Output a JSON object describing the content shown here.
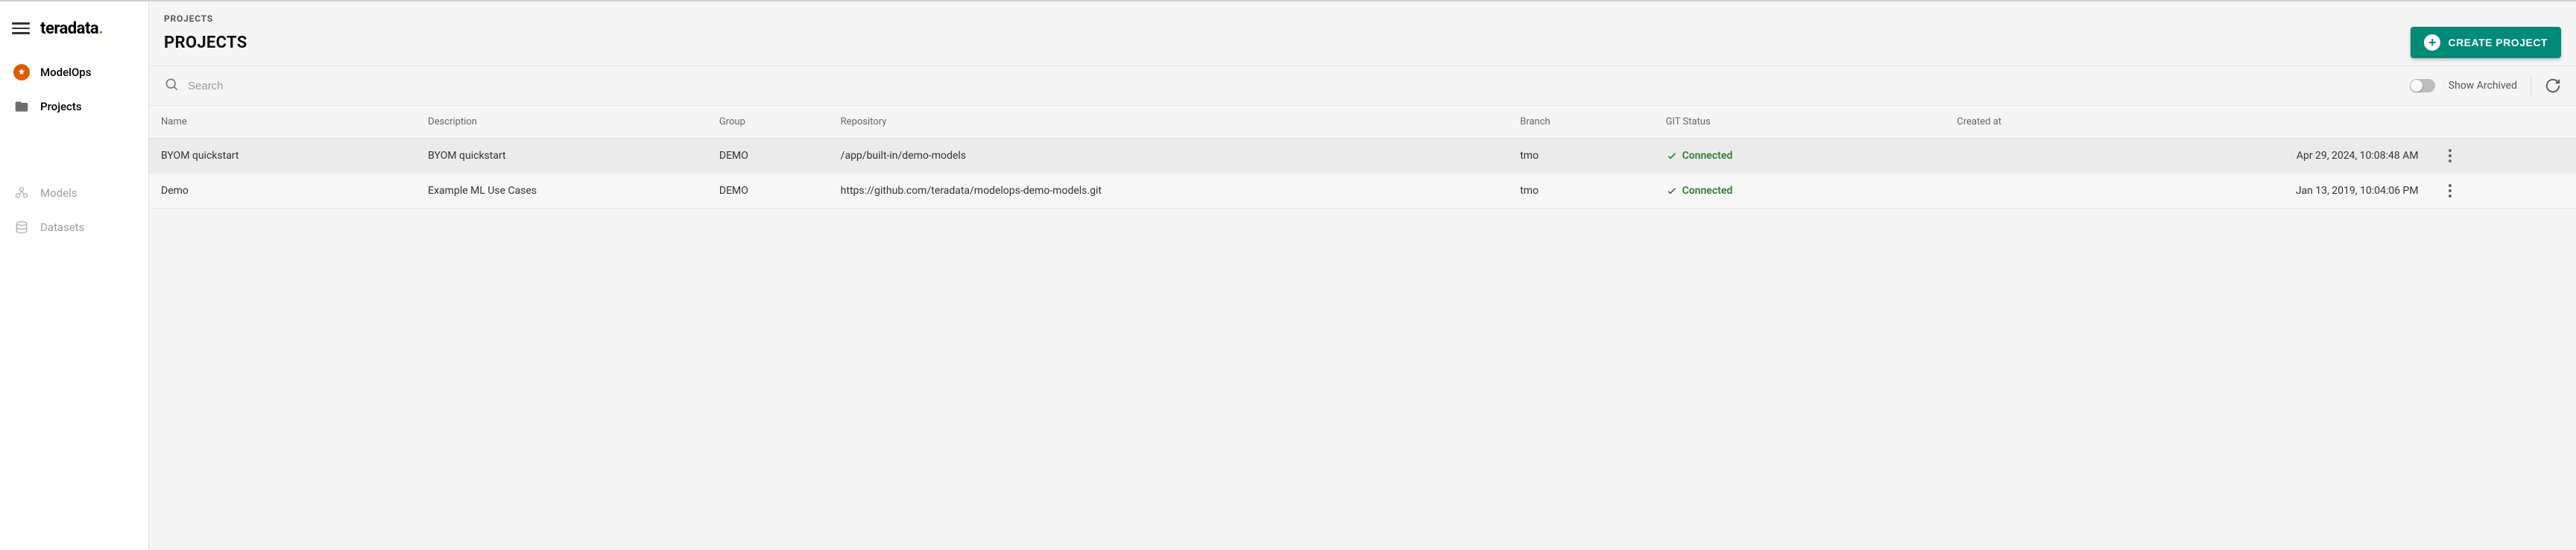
{
  "brand": {
    "name": "teradata",
    "dot": "."
  },
  "sidebar": {
    "items": [
      {
        "label": "ModelOps"
      },
      {
        "label": "Projects"
      },
      {
        "label": "Models"
      },
      {
        "label": "Datasets"
      }
    ]
  },
  "header": {
    "breadcrumb": "PROJECTS",
    "title": "PROJECTS",
    "create_label": "CREATE PROJECT"
  },
  "toolbar": {
    "search_placeholder": "Search",
    "show_archived_label": "Show Archived"
  },
  "table": {
    "columns": {
      "name": "Name",
      "description": "Description",
      "group": "Group",
      "repository": "Repository",
      "branch": "Branch",
      "git_status": "GIT Status",
      "created_at": "Created at"
    },
    "rows": [
      {
        "name": "BYOM quickstart",
        "description": "BYOM quickstart",
        "group": "DEMO",
        "repository": "/app/built-in/demo-models",
        "branch": "tmo",
        "git_status": "Connected",
        "created_at": "Apr 29, 2024, 10:08:48 AM"
      },
      {
        "name": "Demo",
        "description": "Example ML Use Cases",
        "group": "DEMO",
        "repository": "https://github.com/teradata/modelops-demo-models.git",
        "branch": "tmo",
        "git_status": "Connected",
        "created_at": "Jan 13, 2019, 10:04:06 PM"
      }
    ]
  }
}
